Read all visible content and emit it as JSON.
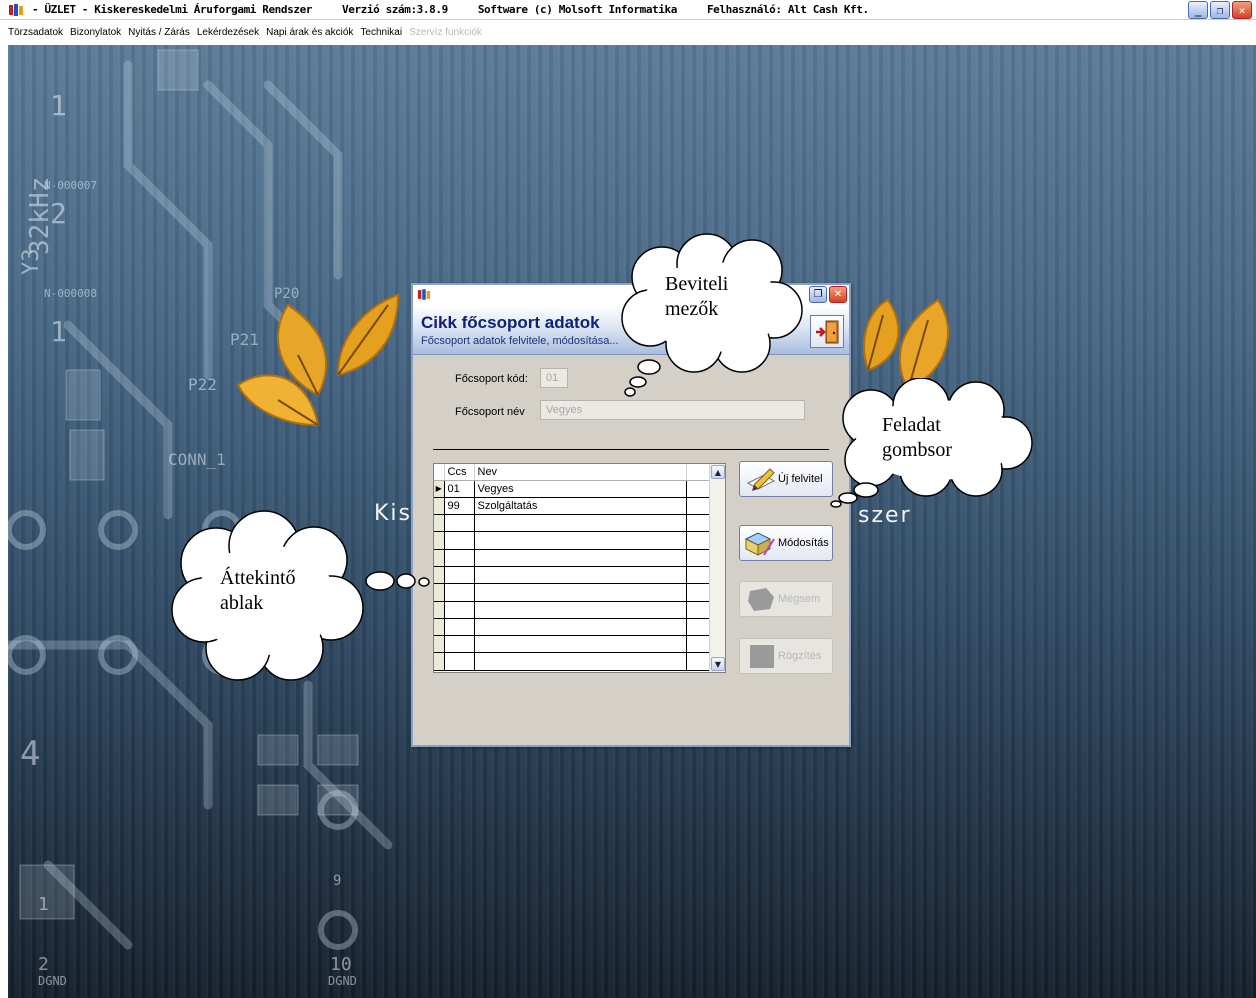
{
  "window": {
    "title_parts": [
      "- ÜZLET - Kiskereskedelmi Áruforgami Rendszer",
      "Verzió szám:3.8.9",
      "Software (c) Molsoft Informatika",
      "Felhasználó: Alt Cash Kft."
    ],
    "controls": [
      "minimize-icon",
      "restore-icon",
      "close-icon"
    ]
  },
  "menu": {
    "items": [
      "Törzsadatok",
      "Bizonylatok",
      "Nyitás / Zárás",
      "Lekérdezések",
      "Napi árak és akciók",
      "Technikai"
    ],
    "disabled_item": "Szervíz funkciók"
  },
  "background": {
    "partial_text_left": "Kis",
    "partial_text_right": "szer",
    "board_labels": [
      "N-000007",
      "N-000008",
      "Y3",
      "32kHz",
      "P20",
      "P21",
      "P22",
      "CONN_1",
      "DGND",
      "DGND",
      "1",
      "2",
      "4",
      "10",
      "9"
    ]
  },
  "dialog": {
    "title": "Cikk főcsoport adatok",
    "subtitle": "Főcsoport adatok felvitele, módosítása...",
    "fields": {
      "code_label": "Főcsoport kód:",
      "code_value": "01",
      "name_label": "Főcsoport név",
      "name_value": "Vegyes"
    },
    "grid": {
      "columns": [
        "Ccs",
        "Nev"
      ],
      "rows": [
        {
          "code": "01",
          "name": "Vegyes"
        },
        {
          "code": "99",
          "name": "Szolgáltatás"
        }
      ]
    },
    "buttons": {
      "new": "Új felvitel",
      "modify": "Módosítás",
      "cancel": "Mégsem",
      "save": "Rögzítés"
    }
  },
  "callouts": {
    "input_fields": [
      "Beviteli",
      "mezők"
    ],
    "task_buttons": [
      "Feladat",
      "gombsor"
    ],
    "overview": [
      "Áttekintő",
      "ablak"
    ]
  },
  "colors": {
    "dialog_title": "#10207a",
    "dialog_bg": "#d4d0c8",
    "leaf": "#e8a628",
    "desk_top": "#5b7a96",
    "desk_bottom": "#151f2c"
  }
}
